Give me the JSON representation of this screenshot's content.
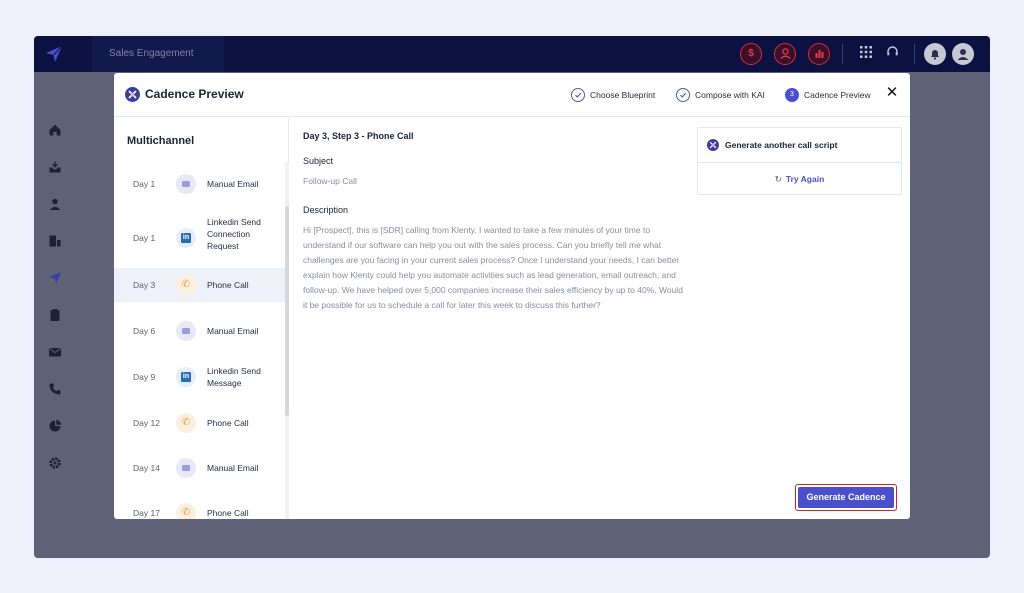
{
  "topbar": {
    "tab_label": "Sales Engagement",
    "red_icons": [
      "dollar-icon",
      "user-icon",
      "chart-icon"
    ],
    "grey_icons": [
      "grid-icon",
      "headset-icon"
    ],
    "right_icons": [
      "bell-icon",
      "avatar-icon"
    ]
  },
  "sidebar": {
    "icons": [
      "home-icon",
      "inbox-icon",
      "contact-icon",
      "company-icon",
      "send-icon",
      "task-icon",
      "mail-icon",
      "phone-icon",
      "report-icon",
      "settings-icon"
    ]
  },
  "modal": {
    "title": "Cadence Preview",
    "steps": [
      {
        "label": "Choose Blueprint",
        "state": "done"
      },
      {
        "label": "Compose with KAI",
        "state": "done"
      },
      {
        "label": "Cadence Preview",
        "state": "current",
        "number": "3"
      }
    ],
    "close": "✕"
  },
  "left_panel": {
    "heading": "Multichannel",
    "items": [
      {
        "day": "Day 1",
        "type": "email",
        "label": "Manual Email"
      },
      {
        "day": "Day 1",
        "type": "linkedin",
        "label": "Linkedin Send Connection Request"
      },
      {
        "day": "Day 3",
        "type": "phone",
        "label": "Phone Call",
        "active": true
      },
      {
        "day": "Day 6",
        "type": "email",
        "label": "Manual Email"
      },
      {
        "day": "Day 9",
        "type": "linkedin",
        "label": "Linkedin Send Message"
      },
      {
        "day": "Day 12",
        "type": "phone",
        "label": "Phone Call"
      },
      {
        "day": "Day 14",
        "type": "email",
        "label": "Manual Email"
      },
      {
        "day": "Day 17",
        "type": "phone",
        "label": "Phone Call"
      }
    ]
  },
  "content": {
    "title": "Day 3, Step 3 - Phone Call",
    "subject_label": "Subject",
    "subject_value": "Follow-up Call",
    "description_label": "Description",
    "description": "Hi [Prospect], this is [SDR] calling from Klenty. I wanted to take a few minutes of your time to understand if our software can help you out with the sales process. Can you briefly tell me what challenges are you facing in your current sales process? Once I understand your needs, I can better explain how Klenty could help you automate activities such as lead generation, email outreach, and follow-up. We have helped over 5,000 companies increase their sales efficiency by up to 40%. Would it be possible for us to schedule a call for later this week to discuss this further?"
  },
  "card": {
    "title": "Generate another call script",
    "retry_label": "Try Again"
  },
  "footer": {
    "generate_label": "Generate Cadence"
  },
  "colors": {
    "accent": "#4a4fcc",
    "topbar": "#0b1140",
    "highlight_outline": "#c9242f"
  }
}
